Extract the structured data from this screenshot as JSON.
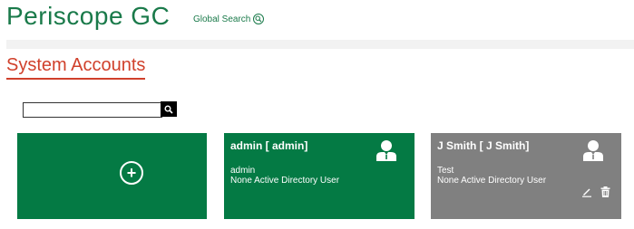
{
  "app": {
    "title": "Periscope GC"
  },
  "header": {
    "global_search_label": "Global Search"
  },
  "page": {
    "title": "System Accounts"
  },
  "search": {
    "value": "",
    "placeholder": ""
  },
  "cards": {
    "add": {
      "icon": "add-circle-icon"
    },
    "accounts": [
      {
        "name": "admin [ admin]",
        "username": "admin",
        "type": "None Active Directory User",
        "color": "#047a44",
        "actions": []
      },
      {
        "name": "J Smith [ J Smith]",
        "username": "Test",
        "type": "None Active Directory User",
        "color": "#808080",
        "actions": [
          "edit-icon",
          "delete-icon"
        ]
      }
    ]
  },
  "colors": {
    "brand": "#1a7a4a",
    "accent": "#d0402b",
    "card_active": "#047a44",
    "card_inactive": "#808080"
  }
}
